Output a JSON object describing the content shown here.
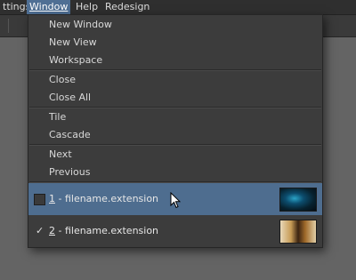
{
  "menubar": {
    "items": [
      {
        "label": "ttings"
      },
      {
        "label": "Window"
      },
      {
        "label": "Help"
      },
      {
        "label": "Redesign"
      }
    ]
  },
  "window_menu": {
    "items": [
      {
        "label": "New Window"
      },
      {
        "label": "New View"
      },
      {
        "label": "Workspace"
      },
      {
        "label": "Close"
      },
      {
        "label": "Close All"
      },
      {
        "label": "Tile"
      },
      {
        "label": "Cascade"
      },
      {
        "label": "Next"
      },
      {
        "label": "Previous"
      }
    ],
    "open_windows": [
      {
        "number": "1",
        "label": " - filename.extension",
        "state": "hovered",
        "thumbnail": "ocean-eye-image"
      },
      {
        "number": "2",
        "label": " - filename.extension",
        "state": "checked",
        "check": "✓",
        "thumbnail": "photo-image"
      }
    ]
  },
  "colors": {
    "menu_bg": "#3c3c3c",
    "highlight": "#4e6d8f",
    "active_menu": "#4f6f94"
  }
}
